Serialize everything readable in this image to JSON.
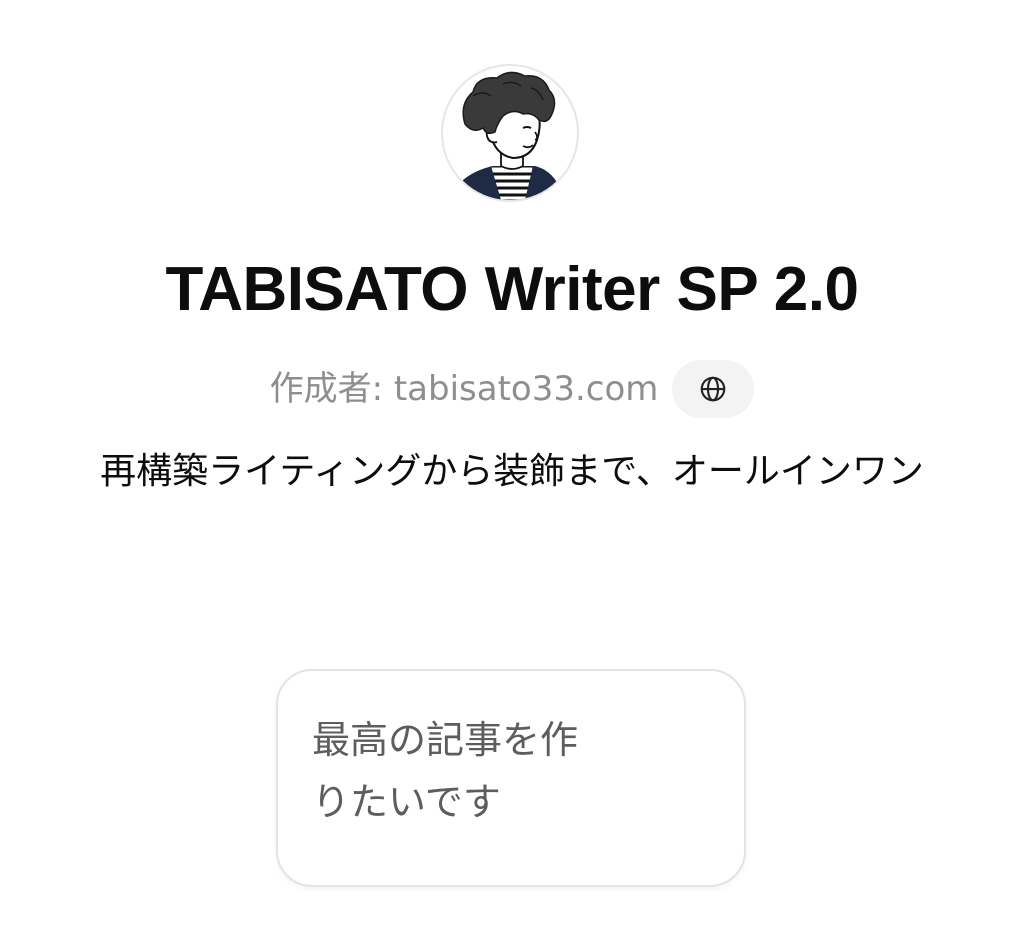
{
  "gpt": {
    "avatar_icon": "illustrated-man-portrait-icon",
    "title": "TABISATO Writer SP 2.0",
    "author": "作成者: tabisato33.com",
    "website_icon": "globe-icon",
    "description": "再構築ライティングから装飾まで、オールインワン"
  },
  "conversation_starters": [
    {
      "label": "最高の記事を作りたいです"
    }
  ],
  "colors": {
    "title": "#0d0d0d",
    "author": "#8e8e8e",
    "starter_text": "#5d5d5d",
    "card_border": "#e3e3e3",
    "chip_bg": "#f3f3f3"
  }
}
